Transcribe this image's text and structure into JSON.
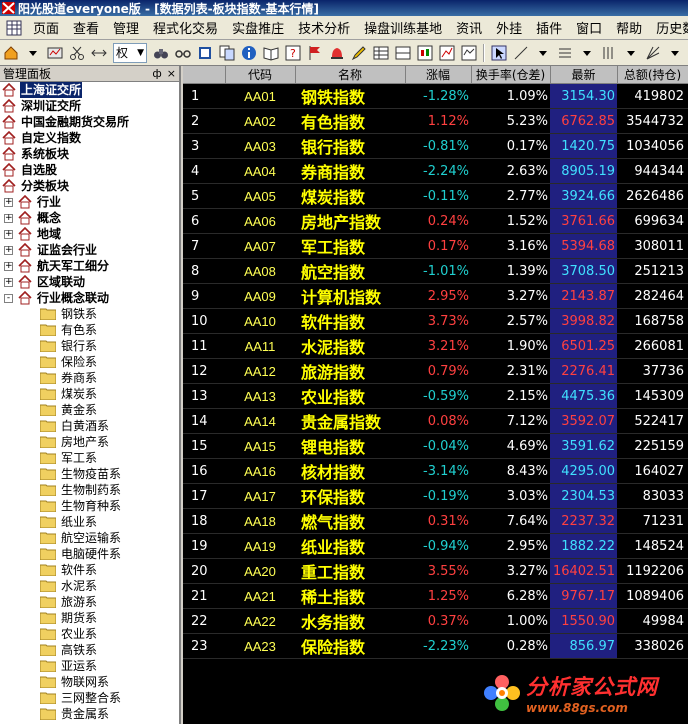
{
  "window": {
    "title": "阳光股道everyone版 - [数据列表-板块指数-基本行情]"
  },
  "menu": [
    "页面",
    "查看",
    "管理",
    "程式化交易",
    "实盘推庄",
    "技术分析",
    "操盘训练基地",
    "资讯",
    "外挂",
    "插件",
    "窗口",
    "帮助",
    "历史数据"
  ],
  "toolbar": {
    "period_select": "权"
  },
  "sidebar": {
    "title": "管理面板",
    "controls": [
      "ф",
      "×"
    ],
    "top_items": [
      {
        "label": "上海证交所",
        "selected": true
      },
      {
        "label": "深圳证交所"
      },
      {
        "label": "中国金融期货交易所"
      },
      {
        "label": "自定义指数"
      },
      {
        "label": "系统板块"
      },
      {
        "label": "自选股"
      },
      {
        "label": "分类板块"
      }
    ],
    "groups": [
      {
        "label": "行业",
        "expander": "+"
      },
      {
        "label": "概念",
        "expander": "+"
      },
      {
        "label": "地域",
        "expander": "+"
      },
      {
        "label": "证监会行业",
        "expander": "+"
      },
      {
        "label": "航天军工细分",
        "expander": "+"
      },
      {
        "label": "区域联动",
        "expander": "+"
      },
      {
        "label": "行业概念联动",
        "expander": "-"
      }
    ],
    "children": [
      "钢铁系",
      "有色系",
      "银行系",
      "保险系",
      "券商系",
      "煤炭系",
      "黄金系",
      "白黄酒系",
      "房地产系",
      "军工系",
      "生物疫苗系",
      "生物制药系",
      "生物育种系",
      "纸业系",
      "航空运输系",
      "电脑硬件系",
      "软件系",
      "水泥系",
      "旅游系",
      "期货系",
      "农业系",
      "高铁系",
      "亚运系",
      "物联网系",
      "三网整合系",
      "贵金属系"
    ]
  },
  "table": {
    "columns": [
      "",
      "代码",
      "名称",
      "涨幅",
      "换手率(仓差)",
      "最新",
      "总额(持仓)"
    ],
    "rows": [
      {
        "idx": "1",
        "code": "AA01",
        "name": "钢铁指数",
        "chg": "-1.28%",
        "turn": "1.09%",
        "price": "3154.30",
        "amt": "419802",
        "dir": "down"
      },
      {
        "idx": "2",
        "code": "AA02",
        "name": "有色指数",
        "chg": "1.12%",
        "turn": "5.23%",
        "price": "6762.85",
        "amt": "3544732",
        "dir": "up"
      },
      {
        "idx": "3",
        "code": "AA03",
        "name": "银行指数",
        "chg": "-0.81%",
        "turn": "0.17%",
        "price": "1420.75",
        "amt": "1034056",
        "dir": "down"
      },
      {
        "idx": "4",
        "code": "AA04",
        "name": "券商指数",
        "chg": "-2.24%",
        "turn": "2.63%",
        "price": "8905.19",
        "amt": "944344",
        "dir": "down"
      },
      {
        "idx": "5",
        "code": "AA05",
        "name": "煤炭指数",
        "chg": "-0.11%",
        "turn": "2.77%",
        "price": "3924.66",
        "amt": "2626486",
        "dir": "down"
      },
      {
        "idx": "6",
        "code": "AA06",
        "name": "房地产指数",
        "chg": "0.24%",
        "turn": "1.52%",
        "price": "3761.66",
        "amt": "699634",
        "dir": "up"
      },
      {
        "idx": "7",
        "code": "AA07",
        "name": "军工指数",
        "chg": "0.17%",
        "turn": "3.16%",
        "price": "5394.68",
        "amt": "308011",
        "dir": "up"
      },
      {
        "idx": "8",
        "code": "AA08",
        "name": "航空指数",
        "chg": "-1.01%",
        "turn": "1.39%",
        "price": "3708.50",
        "amt": "251213",
        "dir": "down"
      },
      {
        "idx": "9",
        "code": "AA09",
        "name": "计算机指数",
        "chg": "2.95%",
        "turn": "3.27%",
        "price": "2143.87",
        "amt": "282464",
        "dir": "up"
      },
      {
        "idx": "10",
        "code": "AA10",
        "name": "软件指数",
        "chg": "3.73%",
        "turn": "2.57%",
        "price": "3998.82",
        "amt": "168758",
        "dir": "up"
      },
      {
        "idx": "11",
        "code": "AA11",
        "name": "水泥指数",
        "chg": "3.21%",
        "turn": "1.90%",
        "price": "6501.25",
        "amt": "266081",
        "dir": "up"
      },
      {
        "idx": "12",
        "code": "AA12",
        "name": "旅游指数",
        "chg": "0.79%",
        "turn": "2.31%",
        "price": "2276.41",
        "amt": "37736",
        "dir": "up"
      },
      {
        "idx": "13",
        "code": "AA13",
        "name": "农业指数",
        "chg": "-0.59%",
        "turn": "2.15%",
        "price": "4475.36",
        "amt": "145309",
        "dir": "down"
      },
      {
        "idx": "14",
        "code": "AA14",
        "name": "贵金属指数",
        "chg": "0.08%",
        "turn": "7.12%",
        "price": "3592.07",
        "amt": "522417",
        "dir": "up"
      },
      {
        "idx": "15",
        "code": "AA15",
        "name": "锂电指数",
        "chg": "-0.04%",
        "turn": "4.69%",
        "price": "3591.62",
        "amt": "225159",
        "dir": "down"
      },
      {
        "idx": "16",
        "code": "AA16",
        "name": "核材指数",
        "chg": "-3.14%",
        "turn": "8.43%",
        "price": "4295.00",
        "amt": "164027",
        "dir": "down"
      },
      {
        "idx": "17",
        "code": "AA17",
        "name": "环保指数",
        "chg": "-0.19%",
        "turn": "3.03%",
        "price": "2304.53",
        "amt": "83033",
        "dir": "down"
      },
      {
        "idx": "18",
        "code": "AA18",
        "name": "燃气指数",
        "chg": "0.31%",
        "turn": "7.64%",
        "price": "2237.32",
        "amt": "71231",
        "dir": "up"
      },
      {
        "idx": "19",
        "code": "AA19",
        "name": "纸业指数",
        "chg": "-0.94%",
        "turn": "2.95%",
        "price": "1882.22",
        "amt": "148524",
        "dir": "down"
      },
      {
        "idx": "20",
        "code": "AA20",
        "name": "重工指数",
        "chg": "3.55%",
        "turn": "3.27%",
        "price": "16402.51",
        "amt": "1192206",
        "dir": "up"
      },
      {
        "idx": "21",
        "code": "AA21",
        "name": "稀土指数",
        "chg": "1.25%",
        "turn": "6.28%",
        "price": "9767.17",
        "amt": "1089406",
        "dir": "up"
      },
      {
        "idx": "22",
        "code": "AA22",
        "name": "水务指数",
        "chg": "0.37%",
        "turn": "1.00%",
        "price": "1550.90",
        "amt": "49984",
        "dir": "up"
      },
      {
        "idx": "23",
        "code": "AA23",
        "name": "保险指数",
        "chg": "-2.23%",
        "turn": "0.28%",
        "price": "856.97",
        "amt": "338026",
        "dir": "down"
      }
    ]
  },
  "watermark": {
    "brand": "分析家公式网",
    "url": "www.88gs.com"
  },
  "colors": {
    "up": "#ff4040",
    "down": "#20d0d0",
    "name": "#ffff00",
    "code": "#ffff55",
    "selection": "#0a246a"
  }
}
